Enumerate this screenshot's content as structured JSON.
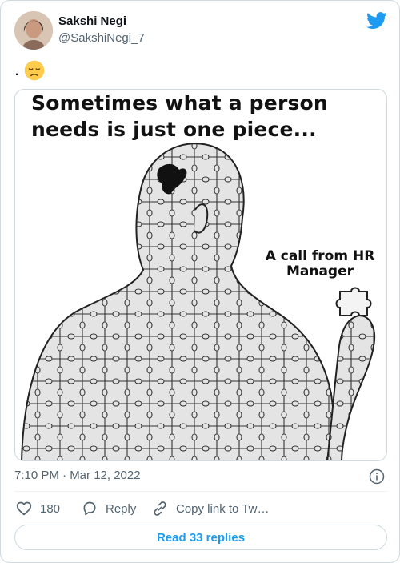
{
  "author": {
    "display_name": "Sakshi Negi",
    "handle": "@SakshiNegi_7"
  },
  "tweet": {
    "text": ".",
    "emoji": "disappointed-face"
  },
  "media": {
    "caption_line1": "Sometimes what a person",
    "caption_line2": "needs is just one piece...",
    "piece_label_line1": "A call from HR",
    "piece_label_line2": "Manager"
  },
  "meta": {
    "timestamp": "7:10 PM · Mar 12, 2022"
  },
  "actions": {
    "like_count": "180",
    "reply_label": "Reply",
    "copy_label": "Copy link to Twe…"
  },
  "read_replies_label": "Read 33 replies",
  "colors": {
    "brand_blue": "#1d9bf0",
    "muted_text": "#536471",
    "border": "#cfd9de"
  }
}
